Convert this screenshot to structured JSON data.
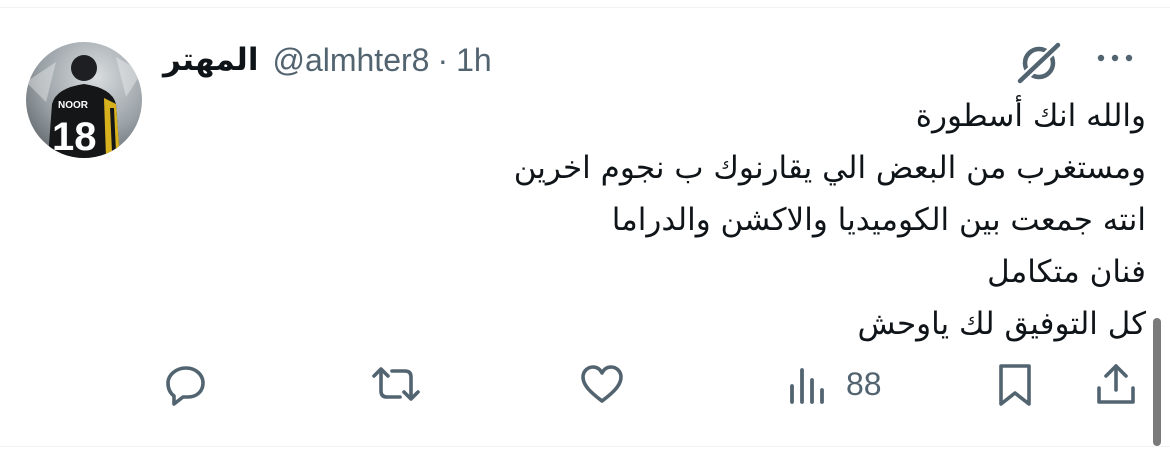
{
  "tweet": {
    "author": {
      "display_name": "المهتر",
      "handle": "@almhter8",
      "avatar_jersey_name": "NOOR",
      "avatar_jersey_number": "18"
    },
    "separator": "·",
    "time": "1h",
    "text_lines": [
      "والله انك أسطورة",
      "ومستغرب من البعض الي يقارنوك ب نجوم اخرين",
      "انته جمعت بين الكوميديا والاكشن والدراما",
      "فنان متكامل",
      "كل التوفيق لك ياوحش"
    ],
    "actions": {
      "views_count": "88"
    },
    "icons": {
      "grok": "grok-icon",
      "more": "more-dots-icon",
      "reply": "reply-icon",
      "retweet": "retweet-icon",
      "like": "heart-icon",
      "views": "views-bar-chart-icon",
      "bookmark": "bookmark-icon",
      "share": "share-icon"
    }
  },
  "colors": {
    "text_primary": "#0f1419",
    "text_secondary": "#536471",
    "divider": "#eff3f4"
  }
}
